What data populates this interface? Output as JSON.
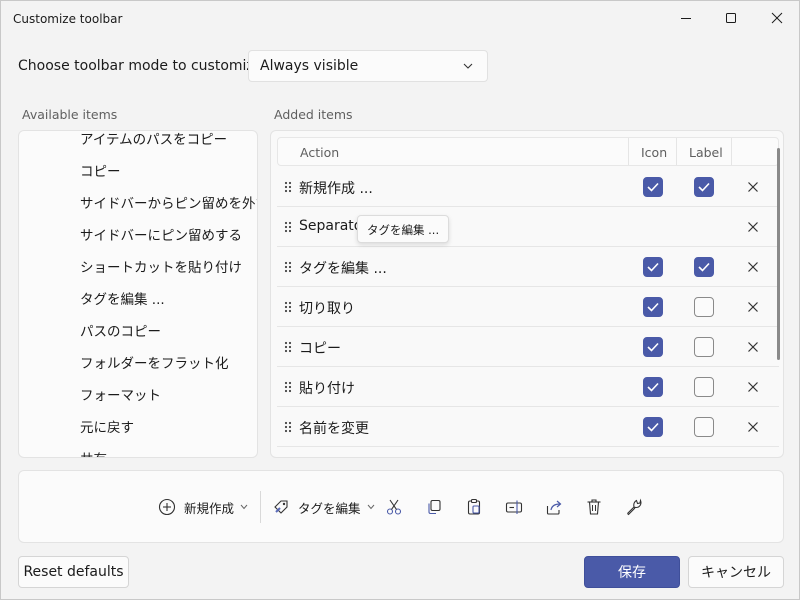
{
  "window": {
    "title": "Customize toolbar"
  },
  "mode": {
    "label": "Choose toolbar mode to customize",
    "value": "Always visible"
  },
  "available": {
    "label": "Available items",
    "items": [
      "アイテムのパスをコピー",
      "コピー",
      "サイドバーからピン留めを外す",
      "サイドバーにピン留めする",
      "ショートカットを貼り付け",
      "タグを編集 ...",
      "パスのコピー",
      "フォルダーをフラット化",
      "フォーマット",
      "元に戻す",
      "共有"
    ]
  },
  "added": {
    "label": "Added items",
    "headers": {
      "action": "Action",
      "icon": "Icon",
      "label": "Label"
    },
    "rows": [
      {
        "name": "新規作成 ...",
        "icon": true,
        "label": true,
        "separator": false
      },
      {
        "name": "Separator",
        "icon": null,
        "label": null,
        "separator": true
      },
      {
        "name": "タグを編集 ...",
        "icon": true,
        "label": true,
        "separator": false
      },
      {
        "name": "切り取り",
        "icon": true,
        "label": false,
        "separator": false
      },
      {
        "name": "コピー",
        "icon": true,
        "label": false,
        "separator": false
      },
      {
        "name": "貼り付け",
        "icon": true,
        "label": false,
        "separator": false
      },
      {
        "name": "名前を変更",
        "icon": true,
        "label": false,
        "separator": false
      }
    ]
  },
  "tooltip": {
    "text": "タグを編集 ..."
  },
  "preview": {
    "new_label": "新規作成",
    "tag_label": "タグを編集",
    "icons": [
      "cut-icon",
      "copy-icon",
      "paste-icon",
      "rename-icon",
      "share-icon",
      "delete-icon",
      "properties-icon"
    ]
  },
  "buttons": {
    "reset": "Reset defaults",
    "save": "保存",
    "cancel": "キャンセル"
  },
  "colors": {
    "accent": "#4a5aa8",
    "background": "#f3f3f3"
  }
}
